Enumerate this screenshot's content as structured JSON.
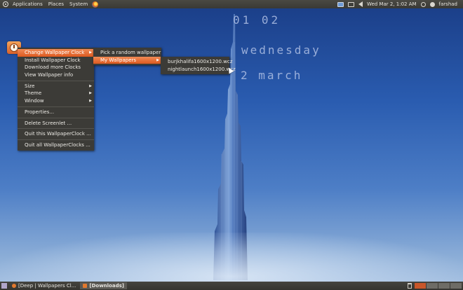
{
  "top_panel": {
    "menus": [
      "Applications",
      "Places",
      "System"
    ],
    "clock": "Wed Mar  2,  1:02 AM",
    "user": "farshad"
  },
  "desklet": {
    "time": "01 02",
    "day": "wednesday",
    "date": "2  march"
  },
  "context_menu": {
    "items": [
      {
        "label": "Change Wallpaper Clock",
        "submenu": true
      },
      {
        "label": "Install Wallpaper Clock"
      },
      {
        "label": "Download more Clocks"
      },
      {
        "label": "View Wallpaper info"
      },
      {
        "label": "Size",
        "submenu": true
      },
      {
        "label": "Theme",
        "submenu": true
      },
      {
        "label": "Window",
        "submenu": true
      },
      {
        "label": "Properties..."
      },
      {
        "label": "Delete Screenlet ..."
      },
      {
        "label": "Quit this WallpaperClock ..."
      },
      {
        "label": "Quit all WallpaperClocks ..."
      }
    ],
    "submenu_change": [
      {
        "label": "Pick a random wallpaper"
      },
      {
        "label": "My Wallpapers",
        "submenu": true
      }
    ],
    "submenu_my_wallpapers": [
      {
        "label": "burjkhalifa1600x1200.wcz"
      },
      {
        "label": "nightlaunch1600x1200.wcz"
      }
    ]
  },
  "taskbar": {
    "tasks": [
      {
        "label": "[Deep | Wallpapers Cl..."
      },
      {
        "label": "[Downloads]"
      }
    ],
    "workspace_count": 4
  },
  "colors": {
    "panel": "#3c3b37",
    "menu_highlight": "#e0632a",
    "wallpaper_sky": "#2a5cb0"
  }
}
